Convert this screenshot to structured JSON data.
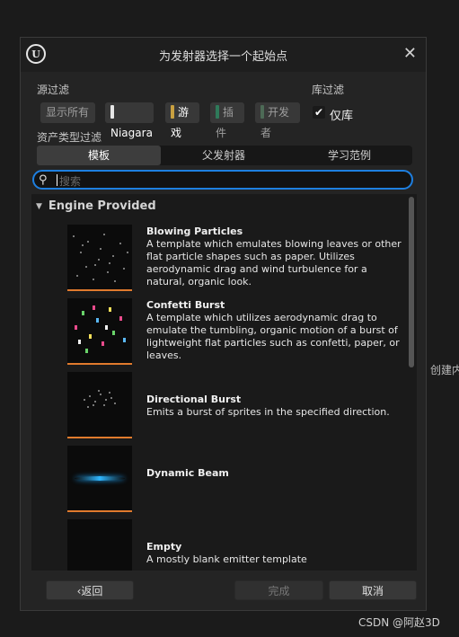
{
  "dialog": {
    "title": "为发射器选择一个起始点",
    "source_filter_label": "源过滤",
    "library_filter_label": "库过滤",
    "asset_type_filter_label": "资产类型过滤",
    "source_chips": [
      {
        "label": "显示所有",
        "color": null
      },
      {
        "label": "Niagara",
        "color": "#e6e6e6"
      },
      {
        "label": "游戏",
        "color": "#c9a040"
      },
      {
        "label": "插件",
        "color": "#2f7a5a"
      },
      {
        "label": "开发者",
        "color": "#4d6a56"
      }
    ],
    "library_only": {
      "label": "仅库",
      "checked": true
    },
    "tabs": [
      "模板",
      "父发射器",
      "学习范例"
    ],
    "active_tab": 0,
    "search": {
      "placeholder": "搜索",
      "value": ""
    },
    "group": "Engine Provided",
    "items": [
      {
        "name": "Blowing Particles",
        "description": "A template which emulates blowing leaves or other flat particle shapes such as paper. Utilizes aerodynamic drag and wind turbulence for a natural, organic look.",
        "thumbnail": "scattered-white-particles"
      },
      {
        "name": "Confetti Burst",
        "description": "A template which utilizes aerodynamic drag to emulate the tumbling, organic motion of a burst of lightweight flat particles such as confetti, paper, or leaves.",
        "thumbnail": "colorful-confetti"
      },
      {
        "name": "Directional Burst",
        "description": "Emits a burst of sprites in the specified direction.",
        "thumbnail": "grey-sprite-burst"
      },
      {
        "name": "Dynamic Beam",
        "description": "",
        "thumbnail": "blue-beam"
      },
      {
        "name": "Empty",
        "description": "A mostly blank emitter template",
        "thumbnail": "blank"
      }
    ],
    "buttons": {
      "back": "返回",
      "finish": "完成",
      "cancel": "取消"
    },
    "accent_color": "#1e7fe0",
    "thumbnail_underline_color": "#e07a2d"
  },
  "background_text": "创建内容",
  "watermark": "CSDN @阿赵3D"
}
